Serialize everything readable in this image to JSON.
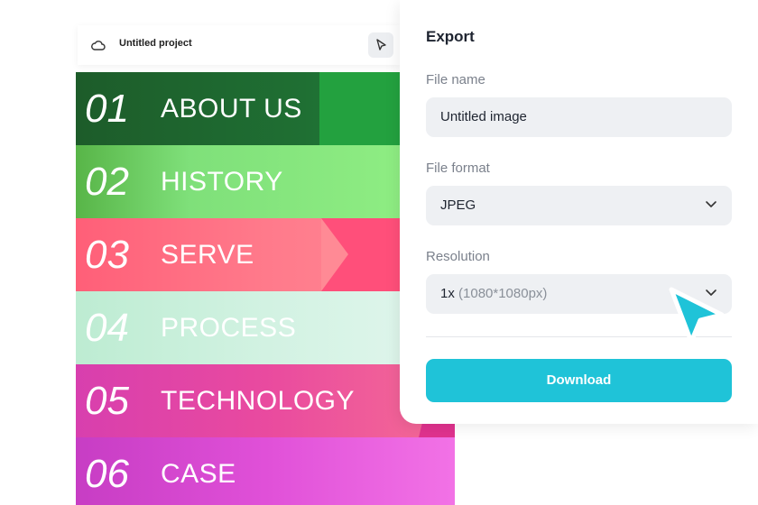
{
  "editor": {
    "project_title": "Untitled project"
  },
  "canvas": {
    "rows": [
      {
        "number": "01",
        "label": "ABOUT US"
      },
      {
        "number": "02",
        "label": "HISTORY"
      },
      {
        "number": "03",
        "label": "SERVE"
      },
      {
        "number": "04",
        "label": "PROCESS"
      },
      {
        "number": "05",
        "label": "TECHNOLOGY"
      },
      {
        "number": "06",
        "label": "CASE"
      }
    ]
  },
  "export_panel": {
    "title": "Export",
    "file_name": {
      "label": "File name",
      "value": "Untitled image"
    },
    "file_format": {
      "label": "File format",
      "value": "JPEG"
    },
    "resolution": {
      "label": "Resolution",
      "value": "1x",
      "detail": "(1080*1080px)"
    },
    "download_label": "Download"
  },
  "icons": {
    "cloud": "cloud-icon",
    "pointer": "pointer-icon",
    "chevron": "chevron-down-icon",
    "cursor": "cursor-arrow-icon"
  },
  "colors": {
    "accent": "#1fc3d8",
    "cursor": "#1fc3d8"
  }
}
